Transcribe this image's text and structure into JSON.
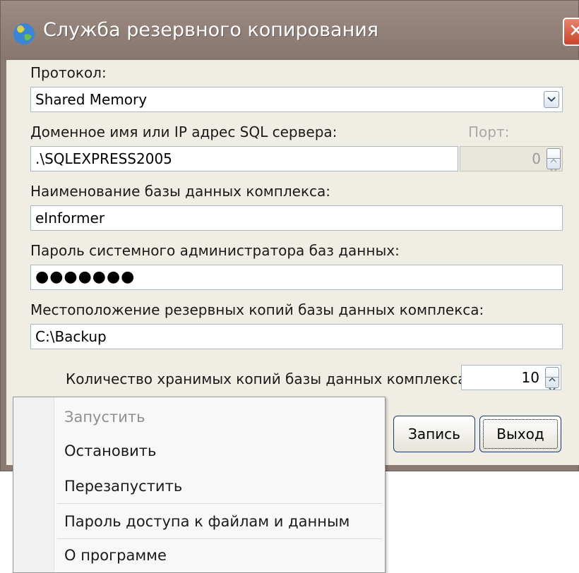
{
  "window": {
    "title": "Служба резервного копирования",
    "close_glyph": "✕",
    "icon": "globe-icon"
  },
  "form": {
    "protocol_label": "Протокол:",
    "protocol_value": "Shared Memory",
    "server_label": "Доменное имя или IP адрес SQL сервера:",
    "server_value": ".\\SQLEXPRESS2005",
    "port_label": "Порт:",
    "port_value": "0",
    "db_name_label": "Наименование базы данных комплекса:",
    "db_name_value": "eInformer",
    "password_label": "Пароль системного администратора баз данных:",
    "password_dots": "●●●●●●●",
    "backup_path_label": "Местоположение резервных копий базы данных комплекса:",
    "backup_path_value": "C:\\Backup",
    "copies_label": "Количество хранимых копий базы данных комплекса:",
    "copies_value": "10"
  },
  "buttons": {
    "save_label": "Запись",
    "exit_label": "Выход"
  },
  "context_menu": {
    "items": [
      {
        "label": "Запустить",
        "enabled": false
      },
      {
        "label": "Остановить",
        "enabled": true
      },
      {
        "label": "Перезапустить",
        "enabled": true
      },
      {
        "label": "Пароль доступа к файлам и данным",
        "enabled": true
      },
      {
        "label": "О программе",
        "enabled": true
      }
    ]
  },
  "colors": {
    "titlebar": "#8a7a72",
    "client_bg": "#f0ede4",
    "close_red": "#c8452c"
  }
}
